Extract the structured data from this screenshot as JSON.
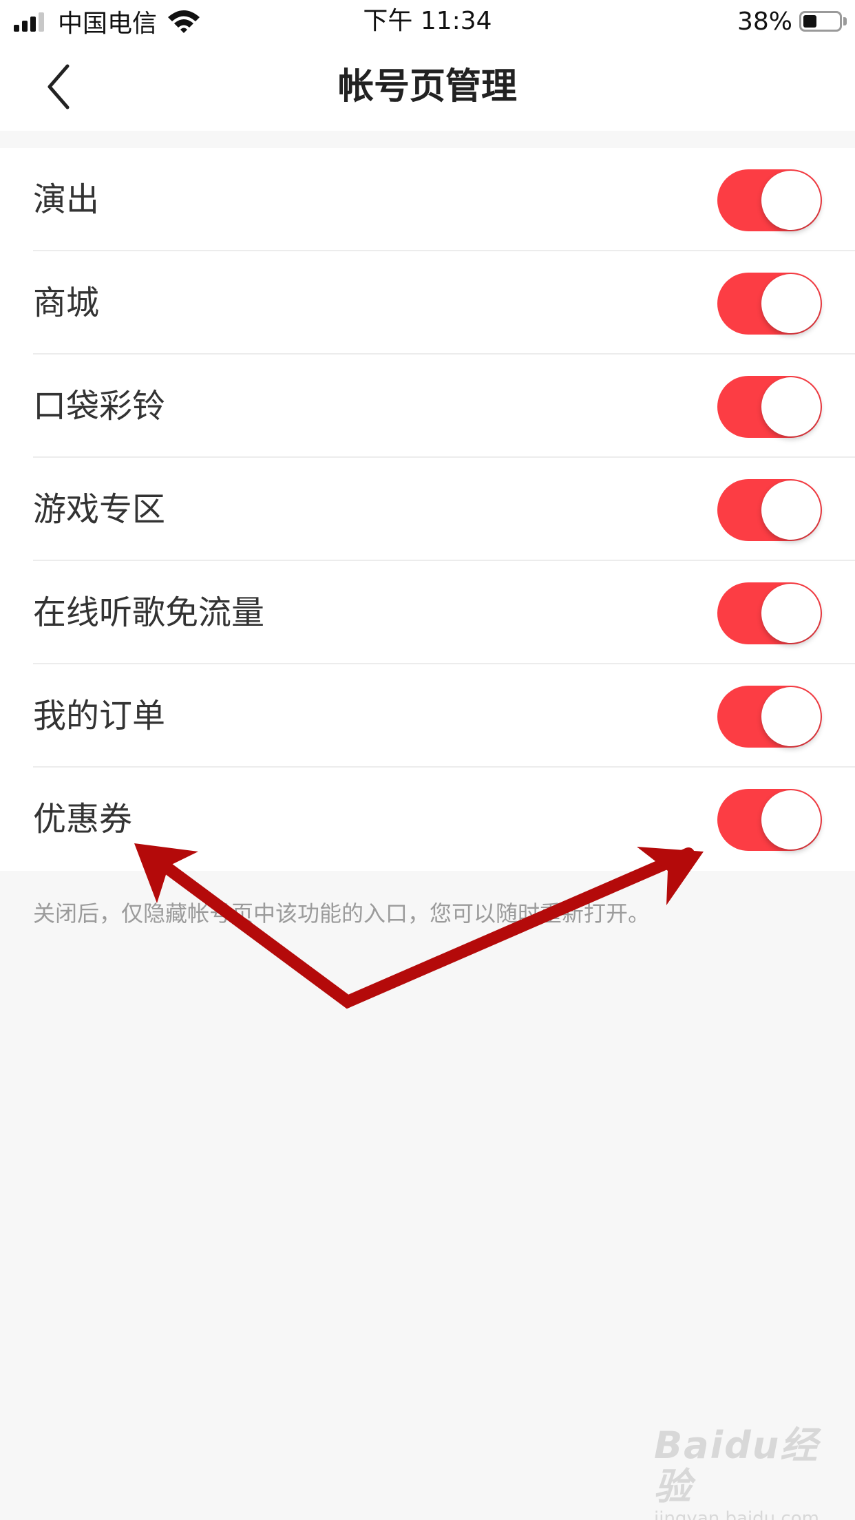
{
  "status_bar": {
    "carrier": "中国电信",
    "time": "下午 11:34",
    "battery_percent_text": "38%",
    "battery_level": 0.38,
    "signal_bars_filled": 3,
    "signal_bars_total": 4
  },
  "nav": {
    "title": "帐号页管理",
    "back_icon": "chevron-left-icon"
  },
  "settings": {
    "items": [
      {
        "label": "演出",
        "enabled": true
      },
      {
        "label": "商城",
        "enabled": true
      },
      {
        "label": "口袋彩铃",
        "enabled": true
      },
      {
        "label": "游戏专区",
        "enabled": true
      },
      {
        "label": "在线听歌免流量",
        "enabled": true
      },
      {
        "label": "我的订单",
        "enabled": true
      },
      {
        "label": "优惠券",
        "enabled": true
      }
    ],
    "footer_note": "关闭后，仅隐藏帐号页中该功能的入口，您可以随时重新打开。"
  },
  "colors": {
    "toggle_on": "#fc3d44",
    "annotation_arrow": "#b40a0a",
    "background": "#f7f7f7"
  },
  "watermark": {
    "brand": "Baidu经验",
    "url": "jingyan.baidu.com"
  }
}
